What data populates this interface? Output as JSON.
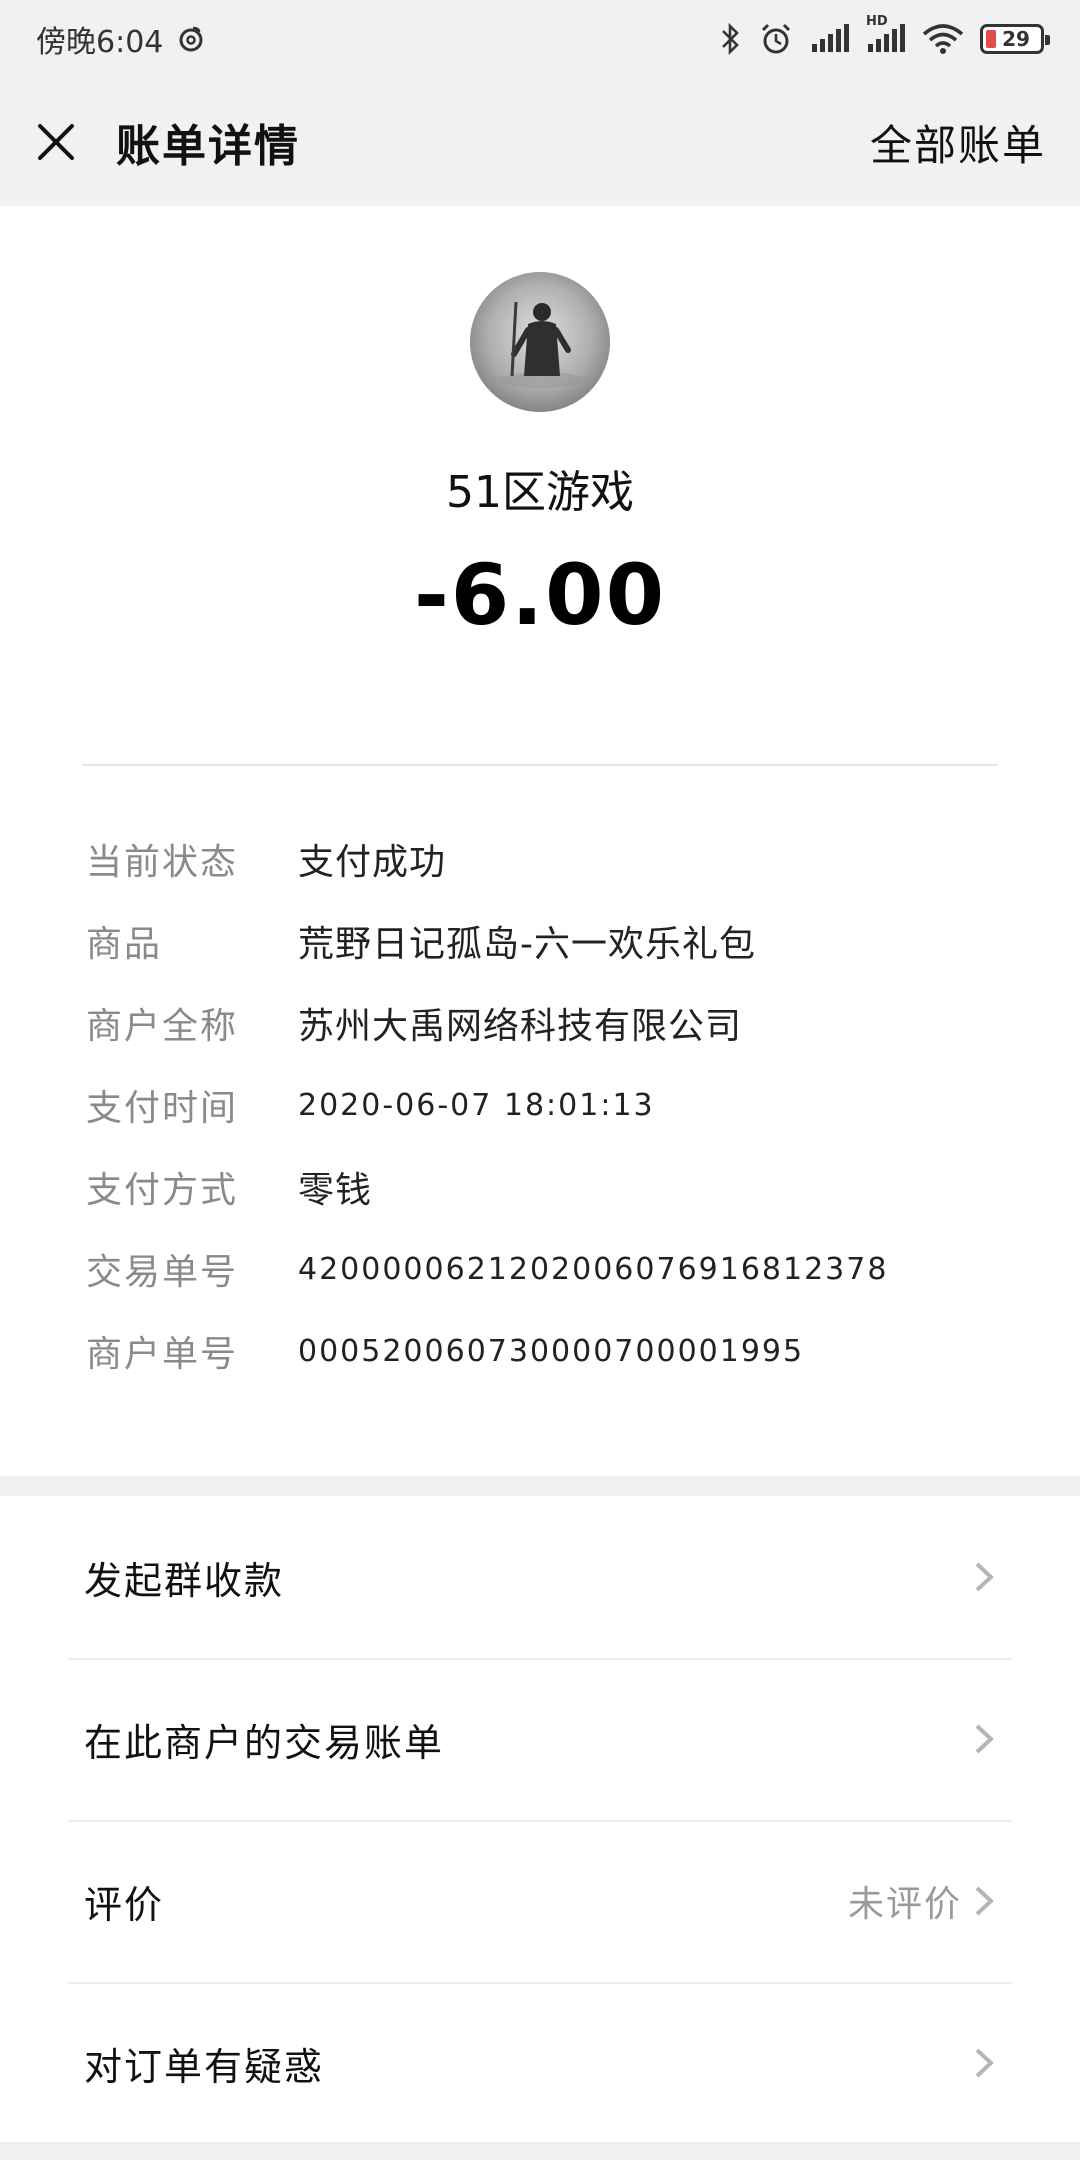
{
  "status_bar": {
    "time": "傍晚6:04",
    "network_badge": "HD",
    "battery": "29"
  },
  "nav": {
    "title": "账单详情",
    "right_link": "全部账单"
  },
  "summary": {
    "merchant_name": "51区游戏",
    "amount": "-6.00"
  },
  "details": [
    {
      "label": "当前状态",
      "value": "支付成功"
    },
    {
      "label": "商品",
      "value": "荒野日记孤岛-六一欢乐礼包"
    },
    {
      "label": "商户全称",
      "value": "苏州大禹网络科技有限公司"
    },
    {
      "label": "支付时间",
      "value": "2020-06-07 18:01:13"
    },
    {
      "label": "支付方式",
      "value": "零钱"
    },
    {
      "label": "交易单号",
      "value": "4200000621202006076916812378"
    },
    {
      "label": "商户单号",
      "value": "000520060730000700001995"
    }
  ],
  "actions": [
    {
      "label": "发起群收款",
      "hint": ""
    },
    {
      "label": "在此商户的交易账单",
      "hint": ""
    },
    {
      "label": "评价",
      "hint": "未评价"
    },
    {
      "label": "对订单有疑惑",
      "hint": ""
    }
  ],
  "colors": {
    "nav_background": "#f1f1f1",
    "label_gray": "#8a8a8a",
    "battery_low": "#e64b4b"
  },
  "icons": {
    "close": "close-icon",
    "chevron": "chevron-right-icon"
  }
}
